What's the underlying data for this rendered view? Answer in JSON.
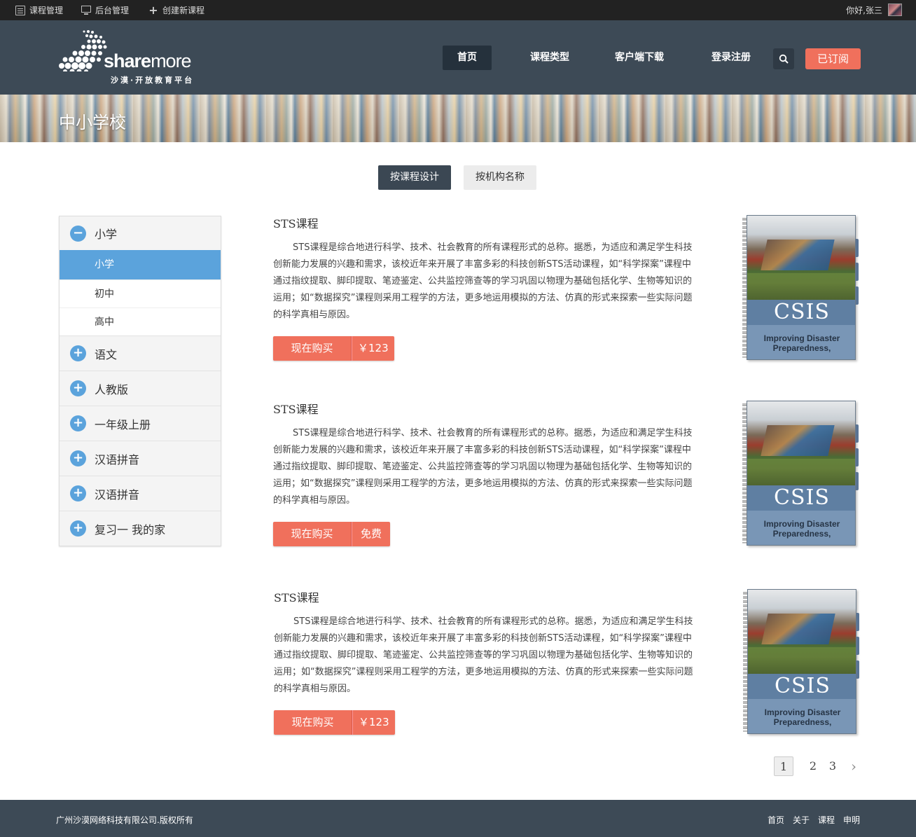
{
  "topbar": {
    "items": [
      {
        "label": "课程管理",
        "icon": "book-icon"
      },
      {
        "label": "后台管理",
        "icon": "monitor-icon"
      },
      {
        "label": "创建新课程",
        "icon": "plus-icon"
      }
    ],
    "greeting": "你好,张三"
  },
  "header": {
    "logo": {
      "brand_bold": "share",
      "brand_light": "more",
      "subtitle": "沙漠·开放教育平台"
    },
    "nav": [
      "首页",
      "课程类型",
      "客户端下载",
      "登录注册"
    ],
    "active_nav": "首页",
    "subscribe_label": "已订阅"
  },
  "banner": {
    "title": "中小学校"
  },
  "filters": {
    "by_design": "按课程设计",
    "by_org": "按机构名称"
  },
  "sidebar": {
    "expanded": {
      "label": "小学",
      "icon": "minus-icon"
    },
    "sub_items": [
      "小学",
      "初中",
      "高中"
    ],
    "selected": "小学",
    "categories": [
      "语文",
      "人教版",
      "一年级上册",
      "汉语拼音",
      "汉语拼音",
      "复习一 我的家"
    ]
  },
  "courses": [
    {
      "title": "STS课程",
      "description": "STS课程是综合地进行科学、技术、社会教育的所有课程形式的总称。据悉，为适应和满足学生科技创新能力发展的兴趣和需求，该校近年来开展了丰富多彩的科技创新STS活动课程，如“科学探案”课程中通过指纹提取、脚印提取、笔迹鉴定、公共监控筛查等的学习巩固以物理为基础包括化学、生物等知识的运用；如“数据探究”课程则采用工程学的方法，更多地运用模拟的方法、仿真的形式来探索一些实际问题的科学真相与原因。",
      "buy_label": "现在购买",
      "price": "￥123",
      "book_brand": "CSIS",
      "book_text": "Improving Disaster Preparedness,"
    },
    {
      "title": "STS课程",
      "description": "STS课程是综合地进行科学、技术、社会教育的所有课程形式的总称。据悉，为适应和满足学生科技创新能力发展的兴趣和需求，该校近年来开展了丰富多彩的科技创新STS活动课程，如“科学探案”课程中通过指纹提取、脚印提取、笔迹鉴定、公共监控筛查等的学习巩固以物理为基础包括化学、生物等知识的运用；如“数据探究”课程则采用工程学的方法，更多地运用模拟的方法、仿真的形式来探索一些实际问题的科学真相与原因。",
      "buy_label": "现在购买",
      "price": "免费",
      "book_brand": "CSIS",
      "book_text": "Improving Disaster Preparedness,"
    },
    {
      "title": "STS课程",
      "description": "STS课程是综合地进行科学、技术、社会教育的所有课程形式的总称。据悉，为适应和满足学生科技创新能力发展的兴趣和需求，该校近年来开展了丰富多彩的科技创新STS活动课程，如“科学探案”课程中通过指纹提取、脚印提取、笔迹鉴定、公共监控筛查等的学习巩固以物理为基础包括化学、生物等知识的运用；如“数据探究”课程则采用工程学的方法，更多地运用模拟的方法、仿真的形式来探索一些实际问题的科学真相与原因。",
      "buy_label": "现在购买",
      "price": "￥123",
      "book_brand": "CSIS",
      "book_text": "Improving Disaster Preparedness,"
    }
  ],
  "pagination": {
    "pages": [
      "1",
      "2",
      "3"
    ],
    "current": "1",
    "next": "›"
  },
  "footer": {
    "copyright": "广州沙漠网络科技有限公司.版权所有",
    "links": [
      "首页",
      "关于",
      "课程",
      "申明"
    ]
  },
  "colors": {
    "accent": "#f0705c",
    "header_bg": "#3d4a56",
    "selected_blue": "#5ba3dc"
  }
}
